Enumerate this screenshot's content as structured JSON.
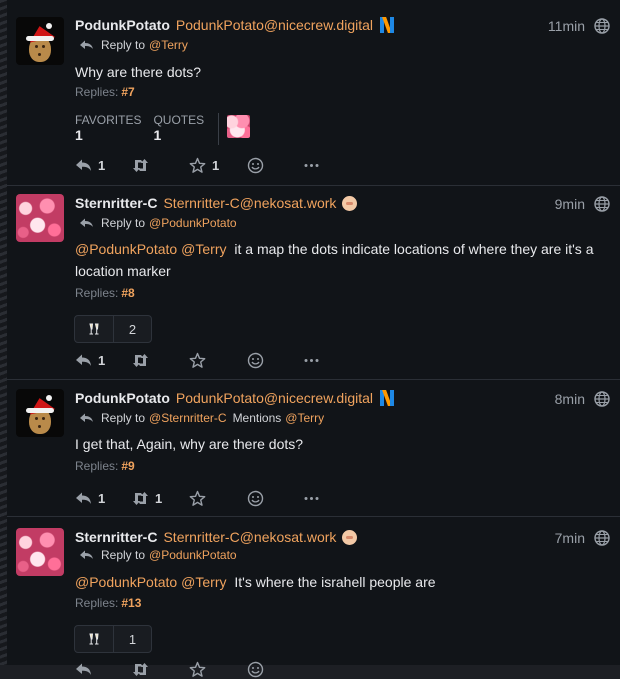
{
  "statuses": [
    {
      "display_name": "PodunkPotato",
      "acct": "PodunkPotato@nicecrew.digital",
      "time": "11min",
      "reply_label": "Reply to",
      "reply_to": "@Terry",
      "mentions_label": "",
      "mentions": "",
      "content_mentions": [],
      "content": "Why are there dots?",
      "replies_label": "Replies:",
      "replies_num": "#7",
      "favorites_label": "FAVORITES",
      "favorites_count": "1",
      "quotes_label": "QUOTES",
      "quotes_count": "1",
      "action_reply_count": "1",
      "action_repeat_count": "",
      "action_favorite_count": "1",
      "reaction_count": ""
    },
    {
      "display_name": "Sternritter-C",
      "acct": "Sternritter-C@nekosat.work",
      "time": "9min",
      "reply_label": "Reply to",
      "reply_to": "@PodunkPotato",
      "mentions_label": "",
      "mentions": "",
      "content_mentions": [
        "@PodunkPotato",
        "@Terry"
      ],
      "content": "it a map the dots indicate locations of where they are it's a location marker",
      "replies_label": "Replies:",
      "replies_num": "#8",
      "action_reply_count": "1",
      "action_repeat_count": "",
      "action_favorite_count": "",
      "reaction_count": "2"
    },
    {
      "display_name": "PodunkPotato",
      "acct": "PodunkPotato@nicecrew.digital",
      "time": "8min",
      "reply_label": "Reply to",
      "reply_to": "@Sternritter-C",
      "mentions_label": "Mentions",
      "mentions": "@Terry",
      "content_mentions": [],
      "content": "I get that, Again, why are there dots?",
      "replies_label": "Replies:",
      "replies_num": "#9",
      "action_reply_count": "1",
      "action_repeat_count": "1",
      "action_favorite_count": "",
      "reaction_count": ""
    },
    {
      "display_name": "Sternritter-C",
      "acct": "Sternritter-C@nekosat.work",
      "time": "7min",
      "reply_label": "Reply to",
      "reply_to": "@PodunkPotato",
      "mentions_label": "",
      "mentions": "",
      "content_mentions": [
        "@PodunkPotato",
        "@Terry"
      ],
      "content": "It's where the israhell people are",
      "replies_label": "Replies:",
      "replies_num": "#13",
      "action_reply_count": "",
      "action_repeat_count": "",
      "action_favorite_count": "",
      "reaction_count": "1"
    }
  ],
  "icons": {
    "reply": "reply-icon",
    "repeat": "repeat-icon",
    "favorite": "star-icon",
    "emoji": "smiley-icon",
    "more": "ellipsis-icon",
    "visibility": "globe-icon"
  },
  "colors": {
    "background": "#111418",
    "accent": "#f0a35e",
    "text": "#e8e9ec",
    "muted": "#9aa0a8"
  }
}
